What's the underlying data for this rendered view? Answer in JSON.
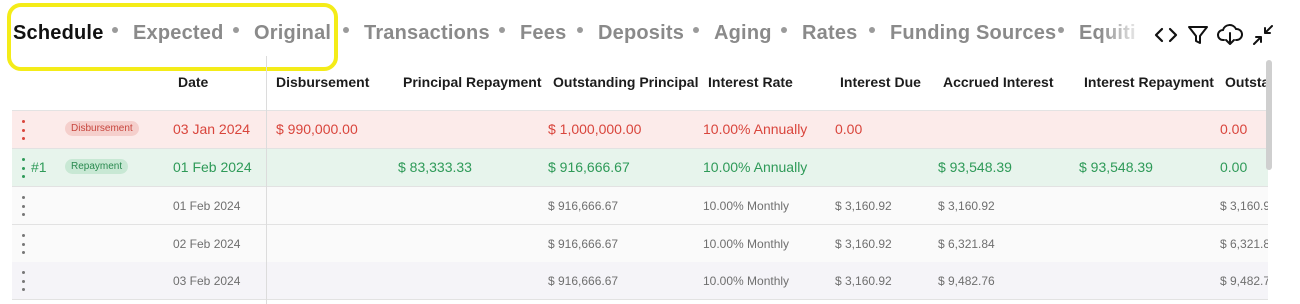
{
  "tabs": [
    {
      "label": "Schedule",
      "active": true
    },
    {
      "label": "Expected",
      "active": false
    },
    {
      "label": "Original",
      "active": false
    },
    {
      "label": "Transactions",
      "active": false
    },
    {
      "label": "Fees",
      "active": false
    },
    {
      "label": "Deposits",
      "active": false
    },
    {
      "label": "Aging",
      "active": false
    },
    {
      "label": "Rates",
      "active": false
    },
    {
      "label": "Funding Sources",
      "active": false
    },
    {
      "label": "Equiti",
      "active": false
    }
  ],
  "toolbar": {
    "icons": [
      "code-icon",
      "filter-icon",
      "cloud-download-icon",
      "collapse-icon"
    ]
  },
  "colors": {
    "highlight": "#f4ec18",
    "disbursement_text": "#d9453c",
    "disbursement_bg": "#fcebea",
    "repayment_text": "#2e9a58",
    "repayment_bg": "#e7f4ec"
  },
  "table": {
    "columns": [
      "Date",
      "Disbursement",
      "Principal Repayment",
      "Outstanding Principal",
      "Interest Rate",
      "Interest Due",
      "Accrued Interest",
      "Interest Repayment",
      "Outsta"
    ],
    "rows": [
      {
        "num": "",
        "badge": "Disbursement",
        "date": "03 Jan 2024",
        "disbursement": "$ 990,000.00",
        "principal_repayment": "",
        "outstanding_principal": "$ 1,000,000.00",
        "interest_rate": "10.00% Annually",
        "interest_due": "0.00",
        "accrued_interest": "",
        "interest_repayment": "",
        "outstanding": "0.00"
      },
      {
        "num": "#1",
        "badge": "Repayment",
        "date": "01 Feb 2024",
        "disbursement": "",
        "principal_repayment": "$ 83,333.33",
        "outstanding_principal": "$ 916,666.67",
        "interest_rate": "10.00% Annually",
        "interest_due": "",
        "accrued_interest": "$ 93,548.39",
        "interest_repayment": "$ 93,548.39",
        "outstanding": "0.00"
      },
      {
        "num": "",
        "badge": "",
        "date": "01 Feb 2024",
        "disbursement": "",
        "principal_repayment": "",
        "outstanding_principal": "$ 916,666.67",
        "interest_rate": "10.00% Monthly",
        "interest_due": "$ 3,160.92",
        "accrued_interest": "$ 3,160.92",
        "interest_repayment": "",
        "outstanding": "$ 3,160.9"
      },
      {
        "num": "",
        "badge": "",
        "date": "02 Feb 2024",
        "disbursement": "",
        "principal_repayment": "",
        "outstanding_principal": "$ 916,666.67",
        "interest_rate": "10.00% Monthly",
        "interest_due": "$ 3,160.92",
        "accrued_interest": "$ 6,321.84",
        "interest_repayment": "",
        "outstanding": "$ 6,321.8"
      },
      {
        "num": "",
        "badge": "",
        "date": "03 Feb 2024",
        "disbursement": "",
        "principal_repayment": "",
        "outstanding_principal": "$ 916,666.67",
        "interest_rate": "10.00% Monthly",
        "interest_due": "$ 3,160.92",
        "accrued_interest": "$ 9,482.76",
        "interest_repayment": "",
        "outstanding": "$ 9,482.7"
      }
    ]
  }
}
